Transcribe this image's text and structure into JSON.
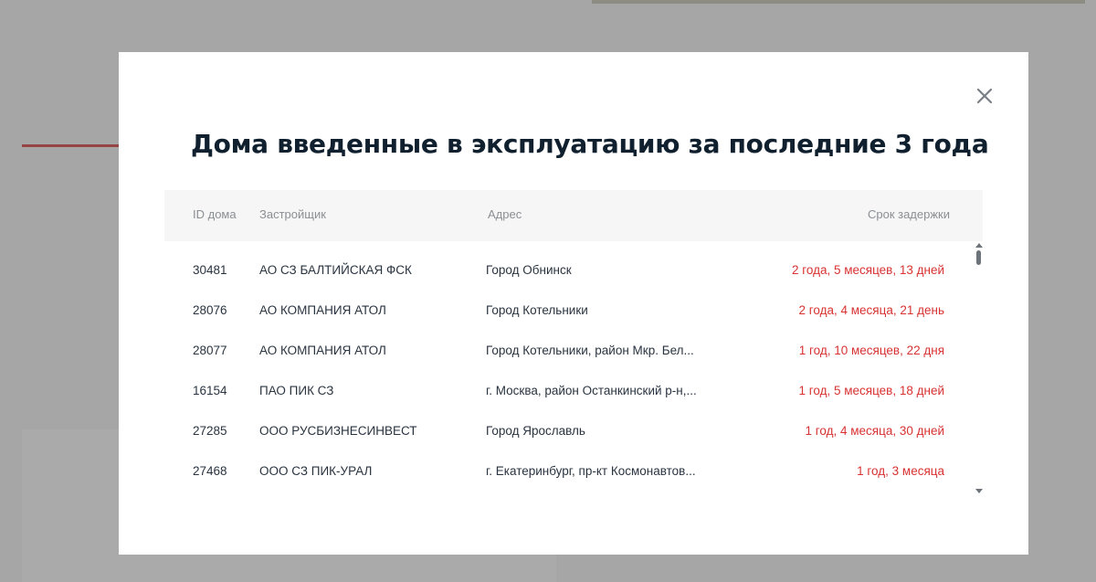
{
  "modal": {
    "title": "Дома введенные в эксплуатацию за последние 3 года",
    "close_icon": "close-icon",
    "columns": {
      "id": "ID дома",
      "developer": "Застройщик",
      "address": "Адрес",
      "delay": "Срок задержки"
    },
    "rows": [
      {
        "id": "30481",
        "developer": "АО СЗ БАЛТИЙСКАЯ ФСК",
        "address": "Город Обнинск",
        "delay": "2 года, 5 месяцев, 13 дней"
      },
      {
        "id": "28076",
        "developer": "АО КОМПАНИЯ АТОЛ",
        "address": "Город Котельники",
        "delay": "2 года, 4 месяца, 21 день"
      },
      {
        "id": "28077",
        "developer": "АО КОМПАНИЯ АТОЛ",
        "address": "Город Котельники, район Мкр. Бел...",
        "delay": "1 год, 10 месяцев, 22 дня"
      },
      {
        "id": "16154",
        "developer": "ПАО ПИК СЗ",
        "address": "г. Москва, район Останкинский р-н,...",
        "delay": "1 год, 5 месяцев, 18 дней"
      },
      {
        "id": "27285",
        "developer": "ООО РУСБИЗНЕСИНВЕСТ",
        "address": "Город Ярославль",
        "delay": "1 год, 4 месяца, 30 дней"
      },
      {
        "id": "27468",
        "developer": "ООО СЗ ПИК-УРАЛ",
        "address": "г. Екатеринбург, пр-кт Космонавтов...",
        "delay": "1 год, 3 месяца"
      }
    ]
  },
  "colors": {
    "title": "#10202e",
    "delay": "#d83232",
    "overlay": "rgba(60,60,60,0.42)"
  }
}
